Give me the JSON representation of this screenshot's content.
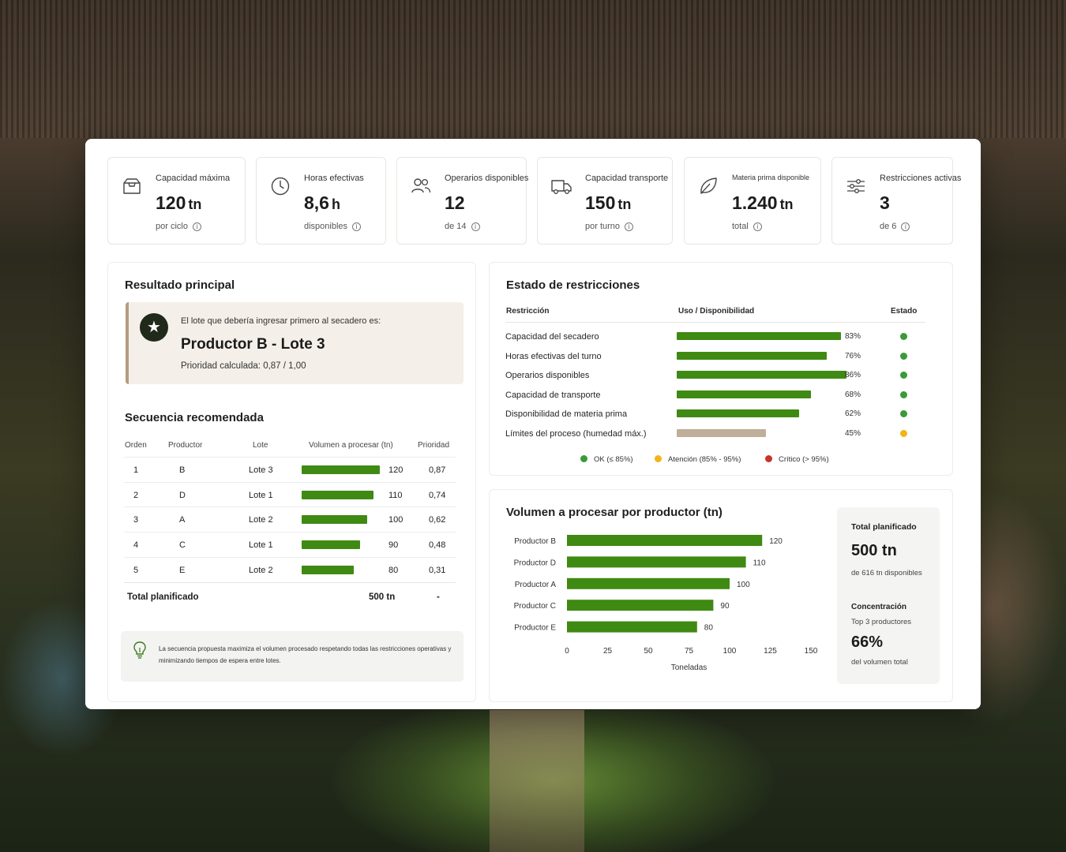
{
  "kpis": [
    {
      "label": "Capacidad máxima",
      "value": "120",
      "unit": "tn",
      "sub": "por ciclo",
      "icon": "box-icon"
    },
    {
      "label": "Horas efectivas",
      "value": "8,6",
      "unit": "h",
      "sub": "disponibles",
      "icon": "clock-icon"
    },
    {
      "label": "Operarios disponibles",
      "value": "12",
      "unit": "",
      "sub": "de 14",
      "icon": "users-icon"
    },
    {
      "label": "Capacidad transporte",
      "value": "150",
      "unit": "tn",
      "sub": "por turno",
      "icon": "truck-icon"
    },
    {
      "label": "Materia prima disponible",
      "value": "1.240",
      "unit": "tn",
      "sub": "total",
      "icon": "leaf-icon"
    },
    {
      "label": "Restricciones activas",
      "value": "3",
      "unit": "",
      "sub": "de 6",
      "icon": "sliders-icon"
    }
  ],
  "info_glyph": "i",
  "result": {
    "title": "Resultado principal",
    "intro": "El lote que debería ingresar primero al secadero es:",
    "main": "Productor B - Lote 3",
    "priority": "Prioridad calculada: 0,87 / 1,00",
    "star": "★"
  },
  "sequence": {
    "title": "Secuencia recomendada",
    "headers": {
      "order": "Orden",
      "producer": "Productor",
      "lot": "Lote",
      "volume": "Volumen a procesar (tn)",
      "priority": "Prioridad"
    },
    "rows": [
      {
        "order": "1",
        "producer": "B",
        "lot": "Lote 3",
        "volume": 120,
        "volume_label": "120",
        "priority": "0,87"
      },
      {
        "order": "2",
        "producer": "D",
        "lot": "Lote 1",
        "volume": 110,
        "volume_label": "110",
        "priority": "0,74"
      },
      {
        "order": "3",
        "producer": "A",
        "lot": "Lote 2",
        "volume": 100,
        "volume_label": "100",
        "priority": "0,62"
      },
      {
        "order": "4",
        "producer": "C",
        "lot": "Lote 1",
        "volume": 90,
        "volume_label": "90",
        "priority": "0,48"
      },
      {
        "order": "5",
        "producer": "E",
        "lot": "Lote 2",
        "volume": 80,
        "volume_label": "80",
        "priority": "0,31"
      }
    ],
    "total_label": "Total planificado",
    "total_value": "500 tn",
    "total_priority": "-",
    "note": "La secuencia propuesta maximiza el volumen procesado respetando todas las restricciones operativas y minimizando tiempos de espera entre lotes."
  },
  "restrictions": {
    "title": "Estado de restricciones",
    "headers": {
      "name": "Restricción",
      "usage": "Uso / Disponibilidad",
      "status": "Estado"
    },
    "rows": [
      {
        "name": "Capacidad del secadero",
        "percent": 83,
        "label": "83%",
        "status": "ok"
      },
      {
        "name": "Horas efectivas del turno",
        "percent": 76,
        "label": "76%",
        "status": "ok"
      },
      {
        "name": "Operarios disponibles",
        "percent": 86,
        "label": "86%",
        "status": "ok"
      },
      {
        "name": "Capacidad de transporte",
        "percent": 68,
        "label": "68%",
        "status": "ok"
      },
      {
        "name": "Disponibilidad de materia prima",
        "percent": 62,
        "label": "62%",
        "status": "ok"
      },
      {
        "name": "Límites del proceso (humedad máx.)",
        "percent": 45,
        "label": "45%",
        "status": "warning"
      }
    ],
    "legend": [
      {
        "label": "OK (≤ 85%)",
        "color": "#3a9a3a"
      },
      {
        "label": "Atención (85% - 95%)",
        "color": "#f2b418"
      },
      {
        "label": "Crítico (> 95%)",
        "color": "#c8332b"
      }
    ]
  },
  "volume": {
    "title": "Volumen a procesar por productor (tn)",
    "side": {
      "t1": "Total planificado",
      "big": "500 tn",
      "s1": "de 616 tn disponibles",
      "t2": "Concentración",
      "s2": "Top 3 productores",
      "big2": "66%",
      "s3": "del volumen total"
    }
  },
  "chart_data": {
    "type": "bar",
    "orientation": "horizontal",
    "categories": [
      "Productor B",
      "Productor D",
      "Productor A",
      "Productor C",
      "Productor E"
    ],
    "values": [
      120,
      110,
      100,
      90,
      80
    ],
    "xlabel": "Toneladas",
    "xlim": [
      0,
      150
    ],
    "xticks": [
      0,
      25,
      50,
      75,
      100,
      125,
      150
    ],
    "bar_color": "#3f8a12",
    "grid": false
  },
  "colors": {
    "accent": "#3f8a12",
    "warning": "#f2b418",
    "neutral_bar": "#bfae9a"
  }
}
